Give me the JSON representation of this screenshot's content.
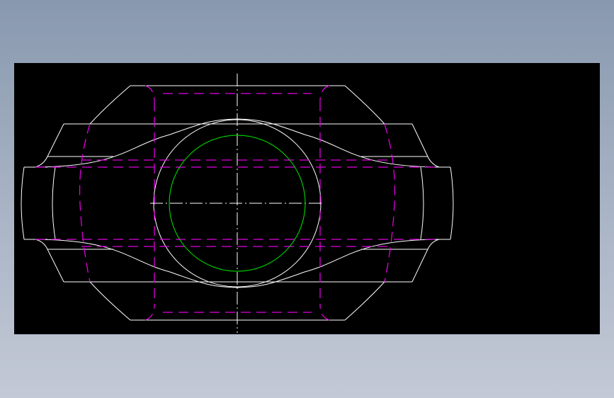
{
  "colors": {
    "background_gradient_top": "#8898ae",
    "background_gradient_bottom": "#c3c9d6",
    "viewport_background": "#000000",
    "outline": "#ffffff",
    "hidden_lines": "#e000e0",
    "centerlines": "#ffffff",
    "bore_circle": "#00c800"
  }
}
